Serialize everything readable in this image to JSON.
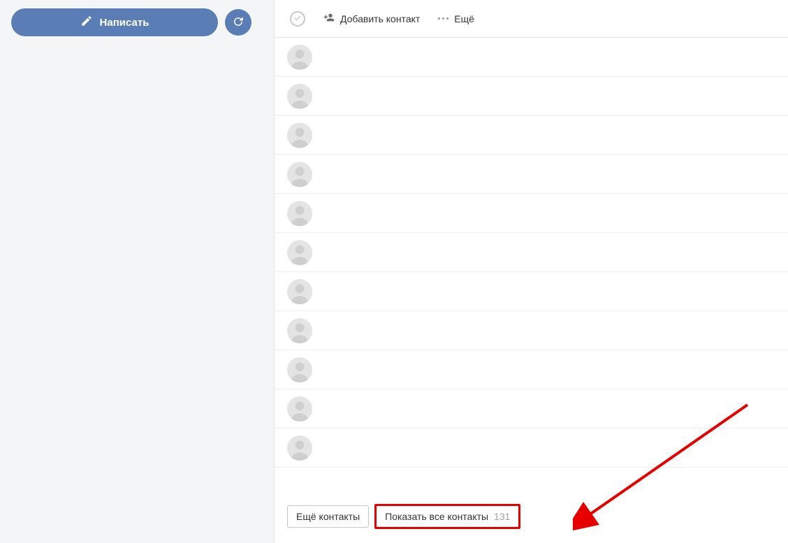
{
  "sidebar": {
    "compose_label": "Написать"
  },
  "toolbar": {
    "add_contact_label": "Добавить контакт",
    "more_label": "Ещё"
  },
  "contacts": {
    "row_count": 11
  },
  "bottom": {
    "more_contacts_label": "Ещё контакты",
    "show_all_label": "Показать все контакты",
    "show_all_count": "131"
  }
}
